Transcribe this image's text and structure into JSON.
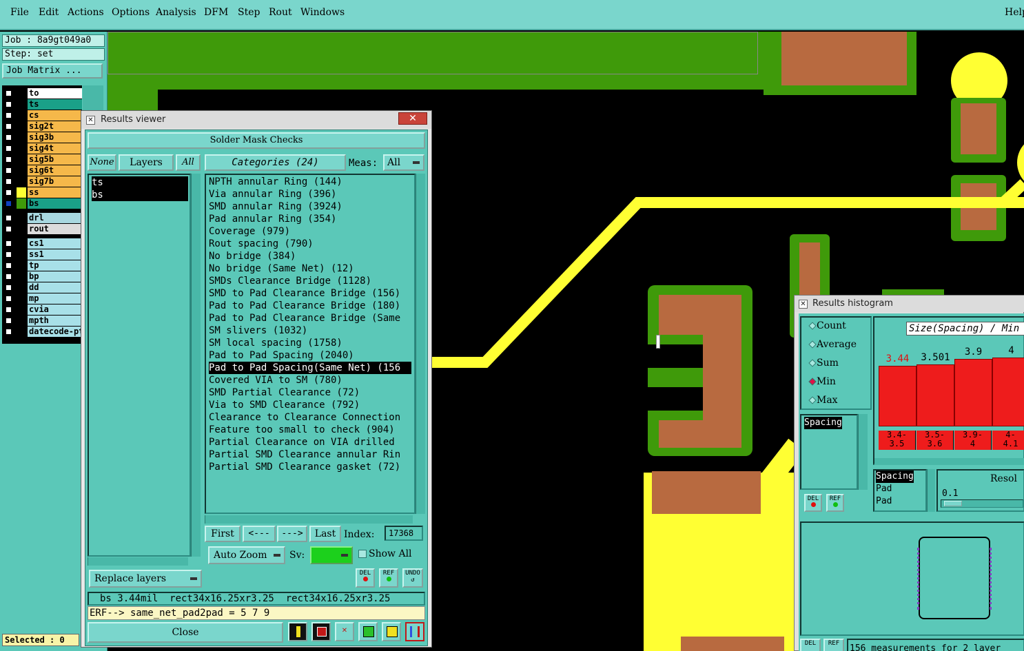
{
  "menubar": {
    "items": [
      "File",
      "Edit",
      "Actions",
      "Options",
      "Analysis",
      "DFM",
      "Step",
      "Rout",
      "Windows"
    ],
    "help": "Help"
  },
  "sidebar": {
    "job": "Job : 8a9gt049a0",
    "step": "Step: set",
    "job_matrix": "Job Matrix ...",
    "layers": [
      {
        "name": "to",
        "color": "#ffffff"
      },
      {
        "name": "ts",
        "color": "#1aa088"
      },
      {
        "name": "cs",
        "color": "#f5b84a"
      },
      {
        "name": "sig2t",
        "color": "#f5b84a"
      },
      {
        "name": "sig3b",
        "color": "#f5b84a"
      },
      {
        "name": "sig4t",
        "color": "#f5b84a"
      },
      {
        "name": "sig5b",
        "color": "#f5b84a"
      },
      {
        "name": "sig6t",
        "color": "#f5b84a"
      },
      {
        "name": "sig7b",
        "color": "#f5b84a"
      },
      {
        "name": "ss",
        "color": "#f5b84a"
      },
      {
        "name": "bs",
        "color": "#1aa088"
      },
      {
        "name": "drl",
        "color": "#a8d8e0"
      },
      {
        "name": "rout",
        "color": "#dcdcdc"
      },
      {
        "name": "cs1",
        "color": "#a8e0e8"
      },
      {
        "name": "ss1",
        "color": "#a8e0e8"
      },
      {
        "name": "tp",
        "color": "#a8e0e8"
      },
      {
        "name": "bp",
        "color": "#a8e0e8"
      },
      {
        "name": "dd",
        "color": "#a8e0e8"
      },
      {
        "name": "mp",
        "color": "#a8e0e8"
      },
      {
        "name": "cvia",
        "color": "#a8e0e8"
      },
      {
        "name": "mpth",
        "color": "#a8e0e8"
      },
      {
        "name": "datecode-pt",
        "color": "#a8e0e8"
      }
    ],
    "selected": "Selected : 0"
  },
  "results_viewer": {
    "title": "Results viewer",
    "close_x": "✕",
    "header": "Solder Mask Checks",
    "none_label": "None",
    "layers_label": "Layers",
    "all_label": "All",
    "categories_label": "Categories (24)",
    "meas_label": "Meas:",
    "meas_value": "All",
    "layer_list": [
      "ts",
      "bs"
    ],
    "categories": [
      "NPTH annular Ring (144)",
      "Via annular Ring (396)",
      "SMD annular Ring (3924)",
      "Pad annular Ring (354)",
      "Coverage (979)",
      "Rout spacing (790)",
      "No bridge (384)",
      "No bridge (Same Net) (12)",
      "SMDs Clearance Bridge (1128)",
      "SMD to Pad Clearance Bridge (156)",
      "Pad to Pad Clearance Bridge (180)",
      "Pad to Pad Clearance Bridge (Same",
      "SM slivers (1032)",
      "SM local spacing (1758)",
      "Pad to Pad Spacing (2040)",
      "Pad to Pad Spacing(Same Net) (156",
      "Covered VIA to SM (780)",
      "SMD Partial Clearance (72)",
      "Via to SMD Clearance (792)",
      "Clearance to Clearance Connection",
      "Feature too small to check (904)",
      "Partial Clearance on VIA drilled",
      "Partial SMD Clearance annular Rin",
      "Partial SMD Clearance gasket (72)"
    ],
    "selected_index": 15,
    "first": "First",
    "prev": "<---",
    "next": "--->",
    "last": "Last",
    "index_label": "Index:",
    "index_value": "17368",
    "auto_zoom": "Auto Zoom",
    "sv_label": "Sv:",
    "show_all": "Show All",
    "replace_layers": "Replace layers",
    "del": "DEL",
    "ref": "REF",
    "undo": "UNDO",
    "status_line": "bs 3.44mil  rect34x16.25xr3.25  rect34x16.25xr3.25",
    "erf_line": "ERF--> same_net_pad2pad = 5 7 9",
    "close": "Close"
  },
  "histogram": {
    "title": "Results histogram",
    "options": [
      "Count",
      "Average",
      "Sum",
      "Min",
      "Max"
    ],
    "selected_option": "Min",
    "chart_title": "Size(Spacing) / Min",
    "bars": [
      {
        "label": "3.44",
        "range": [
          "3.4-",
          "3.5"
        ],
        "highlight": true
      },
      {
        "label": "3.501",
        "range": [
          "3.5-",
          "3.6"
        ],
        "highlight": false
      },
      {
        "label": "3.9",
        "range": [
          "3.9-",
          "4"
        ],
        "highlight": false
      },
      {
        "label": "4",
        "range": [
          "4-",
          "4.1"
        ],
        "highlight": false
      }
    ],
    "list_top": [
      "Spacing"
    ],
    "list_bottom": [
      "Spacing",
      "Pad",
      "Pad"
    ],
    "resol_label": "Resol",
    "resol_value": "0.1",
    "del": "DEL",
    "ref": "REF",
    "footer": "156 measurements for 2 layer"
  }
}
